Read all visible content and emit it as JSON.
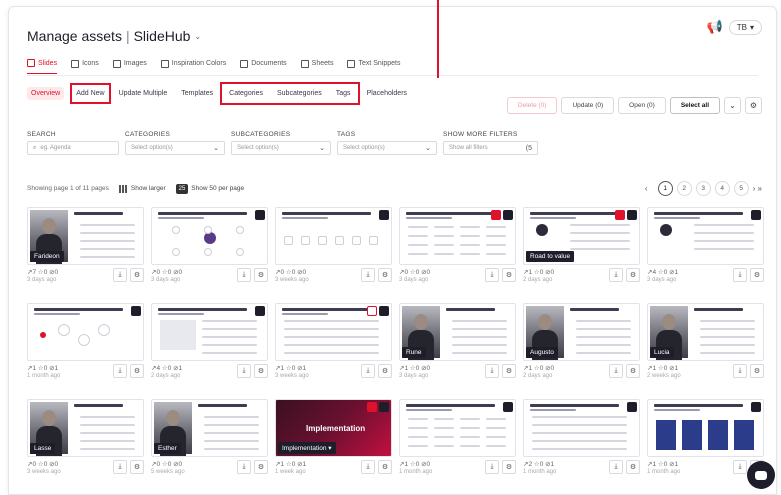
{
  "header": {
    "title": "Manage assets",
    "separator": "|",
    "workspace": "SlideHub",
    "workspace_caret": "⌄",
    "avatar_initials": "TB",
    "avatar_caret": "▾",
    "notification_icon": "megaphone-icon"
  },
  "tabs": [
    {
      "label": "Slides",
      "active": true
    },
    {
      "label": "Icons"
    },
    {
      "label": "Images"
    },
    {
      "label": "Inspiration Colors"
    },
    {
      "label": "Documents"
    },
    {
      "label": "Sheets"
    },
    {
      "label": "Text Snippets"
    }
  ],
  "subnav": {
    "overview": "Overview",
    "add_new": "Add New",
    "update_multiple": "Update Multiple",
    "templates": "Templates",
    "categories": "Categories",
    "subcategories": "Subcategories",
    "tags": "Tags",
    "placeholders": "Placeholders"
  },
  "actions": {
    "delete": "Delete (0)",
    "update": "Update (0)",
    "open": "Open (0)",
    "select_all": "Select all",
    "dropdown": "⌄",
    "settings": "⚙"
  },
  "filters": {
    "search_label": "SEARCH",
    "search_placeholder": "eg. Agenda",
    "categories_label": "CATEGORIES",
    "categories_value": "Select option(s)",
    "subcategories_label": "SUBCATEGORIES",
    "subcategories_value": "Select option(s)",
    "tags_label": "TAGS",
    "tags_value": "Select option(s)",
    "more_label": "SHOW MORE FILTERS",
    "more_value": "Show all filters",
    "more_badge": "(5"
  },
  "paging": {
    "showing": "Showing page 1 of 11 pages",
    "show_larger": "Show larger",
    "per_page_badge": "25",
    "per_page": "Show 50 per page",
    "prev": "‹",
    "pages": [
      "1",
      "2",
      "3",
      "4",
      "5"
    ],
    "next": "› »"
  },
  "cards": [
    {
      "kind": "person",
      "name": "Farideon",
      "stats": "↗7 ☆0 ⊘0",
      "ago": "3 days ago"
    },
    {
      "kind": "diagram",
      "stats": "↗0 ☆0 ⊘0",
      "ago": "3 days ago"
    },
    {
      "kind": "iconrow",
      "stats": "↗0 ☆0 ⊘0",
      "ago": "3 weeks ago"
    },
    {
      "kind": "table",
      "stats": "↗0 ☆0 ⊘0",
      "ago": "3 days ago"
    },
    {
      "kind": "person-mini",
      "name": "Road to value",
      "stats": "↗1 ☆0 ⊘0",
      "ago": "2 days ago"
    },
    {
      "kind": "person-mini2",
      "stats": "↗4 ☆0 ⊘1",
      "ago": "3 days ago"
    },
    {
      "kind": "flow",
      "stats": "↗1 ☆0 ⊘1",
      "ago": "1 month ago"
    },
    {
      "kind": "list",
      "stats": "↗4 ☆0 ⊘1",
      "ago": "2 days ago"
    },
    {
      "kind": "list2",
      "stats": "↗1 ☆0 ⊘1",
      "ago": "3 weeks ago"
    },
    {
      "kind": "person",
      "name": "Rune",
      "stats": "↗1 ☆0 ⊘0",
      "ago": "3 days ago"
    },
    {
      "kind": "person",
      "name": "Augusto",
      "stats": "↗1 ☆0 ⊘0",
      "ago": "2 days ago"
    },
    {
      "kind": "person",
      "name": "Lucia",
      "stats": "↗1 ☆0 ⊘1",
      "ago": "2 weeks ago"
    },
    {
      "kind": "person",
      "name": "Lasse",
      "stats": "↗0 ☆0 ⊘0",
      "ago": "3 weeks ago"
    },
    {
      "kind": "person",
      "name": "Esther",
      "stats": "↗0 ☆0 ⊘0",
      "ago": "5 weeks ago"
    },
    {
      "kind": "dark",
      "name": "Implementation ▾",
      "title": "Implementation",
      "stats": "↗1 ☆0 ⊘1",
      "ago": "1 week ago"
    },
    {
      "kind": "table2",
      "stats": "↗1 ☆0 ⊘0",
      "ago": "1 month ago"
    },
    {
      "kind": "list3",
      "stats": "↗2 ☆0 ⊘1",
      "ago": "1 month ago"
    },
    {
      "kind": "blue",
      "stats": "↗1 ☆0 ⊘1",
      "ago": "1 month ago"
    }
  ],
  "card_actions": {
    "download": "⤓",
    "settings": "⚙"
  },
  "colors": {
    "accent": "#e0112b",
    "dark": "#1e1e2a"
  }
}
